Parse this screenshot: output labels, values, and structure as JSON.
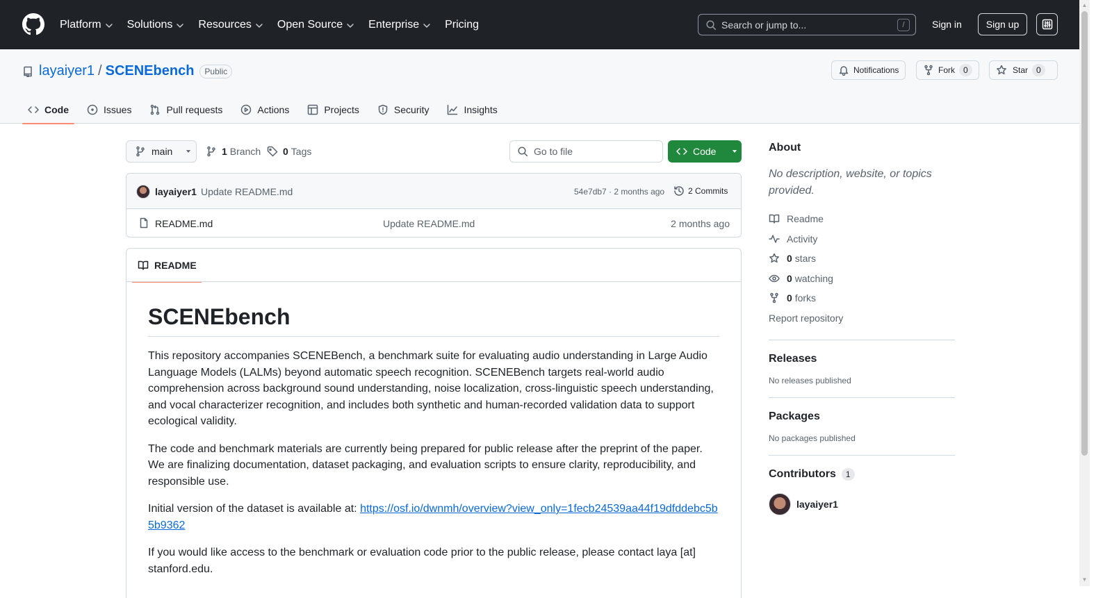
{
  "global_nav": {
    "items": [
      {
        "label": "Platform",
        "has_dropdown": true
      },
      {
        "label": "Solutions",
        "has_dropdown": true
      },
      {
        "label": "Resources",
        "has_dropdown": true
      },
      {
        "label": "Open Source",
        "has_dropdown": true
      },
      {
        "label": "Enterprise",
        "has_dropdown": true
      },
      {
        "label": "Pricing",
        "has_dropdown": false
      }
    ],
    "search_placeholder": "Search or jump to...",
    "search_shortcut": "/",
    "sign_in": "Sign in",
    "sign_up": "Sign up"
  },
  "repo": {
    "owner": "layaiyer1",
    "separator": "/",
    "name": "SCENEbench",
    "visibility": "Public",
    "actions": {
      "notifications": "Notifications",
      "fork_label": "Fork",
      "fork_count": "0",
      "star_label": "Star",
      "star_count": "0"
    },
    "tabs": [
      {
        "label": "Code",
        "icon": "code-icon",
        "active": true
      },
      {
        "label": "Issues",
        "icon": "issue-icon",
        "active": false
      },
      {
        "label": "Pull requests",
        "icon": "pull-request-icon",
        "active": false
      },
      {
        "label": "Actions",
        "icon": "play-icon",
        "active": false
      },
      {
        "label": "Projects",
        "icon": "table-icon",
        "active": false
      },
      {
        "label": "Security",
        "icon": "shield-icon",
        "active": false
      },
      {
        "label": "Insights",
        "icon": "graph-icon",
        "active": false
      }
    ]
  },
  "toolbar": {
    "branch": "main",
    "branch_count": "1",
    "branch_label": "Branch",
    "tag_count": "0",
    "tag_label": "Tags",
    "go_to_file": "Go to file",
    "code_button": "Code"
  },
  "latest_commit": {
    "author": "layaiyer1",
    "message": "Update README.md",
    "hash_time": "54e7db7 · 2 months ago",
    "commits_label": "2 Commits"
  },
  "files": [
    {
      "name": "README.md",
      "message": "Update README.md",
      "age": "2 months ago"
    }
  ],
  "readme": {
    "tab_label": "README",
    "title": "SCENEbench",
    "p1": "This repository accompanies SCENEBench, a benchmark suite for evaluating audio understanding in Large Audio Language Models (LALMs) beyond automatic speech recognition. SCENEBench targets real-world audio comprehension across background sound understanding, noise localization, cross-linguistic speech understanding, and vocal characterizer recognition, and includes both synthetic and human-recorded validation data to support ecological validity.",
    "p2": "The code and benchmark materials are currently being prepared for public release after the preprint of the paper. We are finalizing documentation, dataset packaging, and evaluation scripts to ensure clarity, reproducibility, and responsible use.",
    "p3_prefix": "Initial version of the dataset is available at: ",
    "p3_link": "https://osf.io/dwnmh/overview?view_only=1fecb24539aa44f19dfddebc5b5b9362",
    "p4": "If you would like access to the benchmark or evaluation code prior to the public release, please contact laya [at] stanford.edu."
  },
  "sidebar": {
    "about_title": "About",
    "about_desc": "No description, website, or topics provided.",
    "links": {
      "readme": "Readme",
      "activity": "Activity",
      "stars_count": "0",
      "stars_label": "stars",
      "watching_count": "0",
      "watching_label": "watching",
      "forks_count": "0",
      "forks_label": "forks",
      "report": "Report repository"
    },
    "releases_title": "Releases",
    "releases_empty": "No releases published",
    "packages_title": "Packages",
    "packages_empty": "No packages published",
    "contributors_title": "Contributors",
    "contributors_count": "1",
    "contributors": [
      {
        "login": "layaiyer1"
      }
    ]
  },
  "colors": {
    "header_bg": "#1f2328",
    "accent_link": "#0969da",
    "primary_green": "#1f883d",
    "active_tab_underline": "#fd8c73"
  }
}
